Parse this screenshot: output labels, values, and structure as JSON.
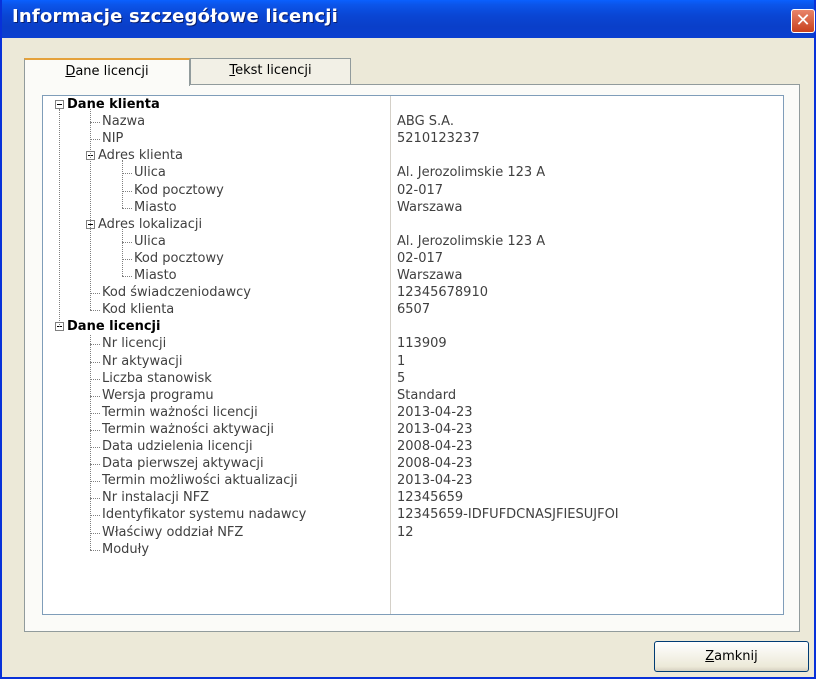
{
  "window": {
    "title": "Informacje szczegółowe licencji"
  },
  "tabs": [
    {
      "mnemonic": "D",
      "rest": "ane licencji",
      "active": true
    },
    {
      "mnemonic": "T",
      "rest": "ekst licencji",
      "active": false
    }
  ],
  "tree": [
    {
      "label": "Dane klienta",
      "value": "",
      "bold": true,
      "expander": true
    },
    {
      "label": "Nazwa",
      "value": "ABG S.A."
    },
    {
      "label": "NIP",
      "value": "5210123237"
    },
    {
      "label": "Adres klienta",
      "value": "",
      "expander": true
    },
    {
      "label": "Ulica",
      "value": "Al. Jerozolimskie 123 A"
    },
    {
      "label": "Kod pocztowy",
      "value": "02-017"
    },
    {
      "label": "Miasto",
      "value": "Warszawa"
    },
    {
      "label": "Adres lokalizacji",
      "value": "",
      "expander": true
    },
    {
      "label": "Ulica",
      "value": "Al. Jerozolimskie 123 A"
    },
    {
      "label": "Kod pocztowy",
      "value": "02-017"
    },
    {
      "label": "Miasto",
      "value": "Warszawa"
    },
    {
      "label": "Kod świadczeniodawcy",
      "value": "12345678910"
    },
    {
      "label": "Kod klienta",
      "value": "6507"
    },
    {
      "label": "Dane licencji",
      "value": "",
      "bold": true,
      "expander": true
    },
    {
      "label": "Nr licencji",
      "value": "113909"
    },
    {
      "label": "Nr aktywacji",
      "value": "1"
    },
    {
      "label": "Liczba stanowisk",
      "value": "5"
    },
    {
      "label": "Wersja programu",
      "value": "Standard"
    },
    {
      "label": "Termin ważności licencji",
      "value": "2013-04-23"
    },
    {
      "label": "Termin ważności aktywacji",
      "value": "2013-04-23"
    },
    {
      "label": "Data udzielenia licencji",
      "value": "2008-04-23"
    },
    {
      "label": "Data pierwszej aktywacji",
      "value": "2008-04-23"
    },
    {
      "label": "Termin możliwości aktualizacji",
      "value": "2013-04-23"
    },
    {
      "label": "Nr instalacji NFZ",
      "value": "12345659"
    },
    {
      "label": "Identyfikator systemu nadawcy",
      "value": "12345659-IDFUFDCNASJFIESUJFOI"
    },
    {
      "label": "Właściwy oddział NFZ",
      "value": "12"
    },
    {
      "label": "Moduły",
      "value": ""
    }
  ],
  "footer": {
    "close_mnemonic": "Z",
    "close_rest": "amknij"
  },
  "colors": {
    "titlebar": "#0a46d4",
    "window_bg": "#ece9d8",
    "close_button": "#c8401e",
    "active_tab_accent": "#e5a23b"
  }
}
